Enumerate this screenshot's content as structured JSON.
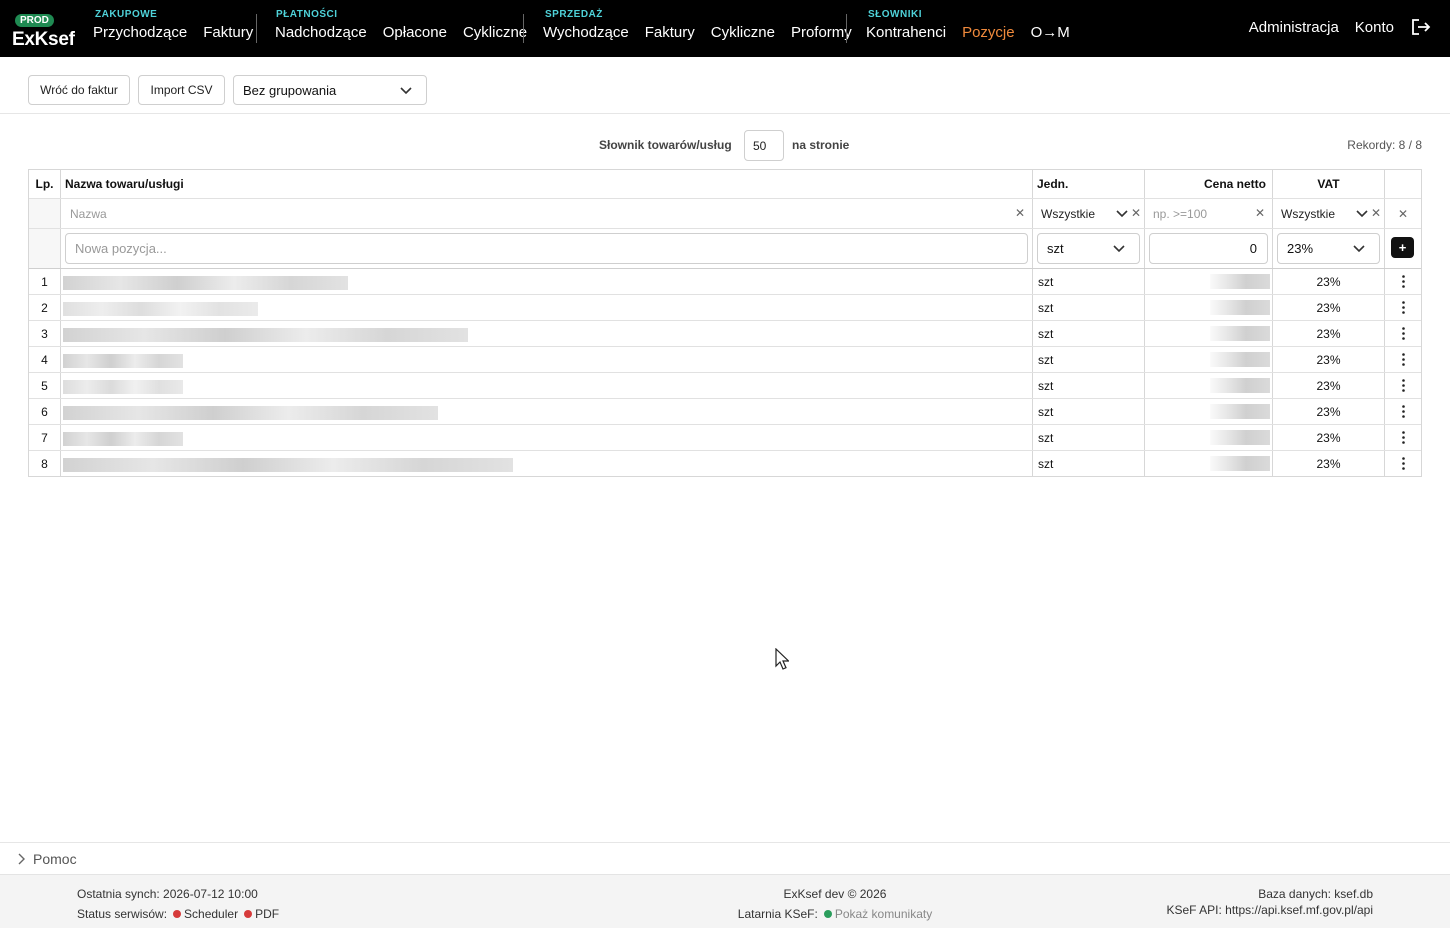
{
  "nav": {
    "env_badge": "PROD",
    "brand": "ExKsef",
    "groups": [
      {
        "title": "ZAKUPOWE",
        "items": [
          "Przychodzące",
          "Faktury"
        ]
      },
      {
        "title": "PŁATNOŚCI",
        "items": [
          "Nadchodzące",
          "Opłacone",
          "Cykliczne"
        ]
      },
      {
        "title": "SPRZEDAŻ",
        "items": [
          "Wychodzące",
          "Faktury",
          "Cykliczne",
          "Proformy"
        ]
      },
      {
        "title": "SŁOWNIKI",
        "items": [
          "Kontrahenci",
          "Pozycje",
          "O→M"
        ]
      }
    ],
    "active_item": "Pozycje",
    "right": {
      "admin": "Administracja",
      "account": "Konto",
      "logout_icon": "logout-icon"
    },
    "accent_color": "#4fd2d9",
    "active_color": "#f08a3c"
  },
  "toolbar": {
    "back_label": "Wróć do faktur",
    "import_label": "Import CSV",
    "grouping_value": "Bez grupowania"
  },
  "pager": {
    "label_before": "Słownik towarów/usług",
    "per_page": "50",
    "label_after": "na stronie",
    "records": "Rekordy: 8 / 8"
  },
  "table": {
    "headers": {
      "lp": "Lp.",
      "name": "Nazwa towaru/usługi",
      "unit": "Jedn.",
      "price": "Cena netto",
      "vat": "VAT"
    },
    "filters": {
      "name_placeholder": "Nazwa",
      "unit_value": "Wszystkie",
      "price_placeholder": "np. >=100",
      "vat_value": "Wszystkie"
    },
    "new_row": {
      "name_placeholder": "Nowa pozycja...",
      "unit": "szt",
      "price": "0",
      "vat": "23%",
      "add_label": "+"
    },
    "rows": [
      {
        "lp": "1",
        "unit": "szt",
        "vat": "23%"
      },
      {
        "lp": "2",
        "unit": "szt",
        "vat": "23%"
      },
      {
        "lp": "3",
        "unit": "szt",
        "vat": "23%"
      },
      {
        "lp": "4",
        "unit": "szt",
        "vat": "23%"
      },
      {
        "lp": "5",
        "unit": "szt",
        "vat": "23%"
      },
      {
        "lp": "6",
        "unit": "szt",
        "vat": "23%"
      },
      {
        "lp": "7",
        "unit": "szt",
        "vat": "23%"
      },
      {
        "lp": "8",
        "unit": "szt",
        "vat": "23%"
      }
    ]
  },
  "help": {
    "label": "Pomoc"
  },
  "footer": {
    "last_sync": "Ostatnia synch: 2026-07-12 10:00",
    "services_label": "Status serwisów:",
    "service_1": "Scheduler",
    "service_2": "PDF",
    "service_status_color": "#d63a3a",
    "copyright": "ExKsef dev © 2026",
    "latarnia_label": "Latarnia KSeF:",
    "latarnia_link": "Pokaż komunikaty",
    "latarnia_color": "#2a9d5c",
    "database": "Baza danych: ksef.db",
    "api": "KSeF API: https://api.ksef.mf.gov.pl/api"
  }
}
